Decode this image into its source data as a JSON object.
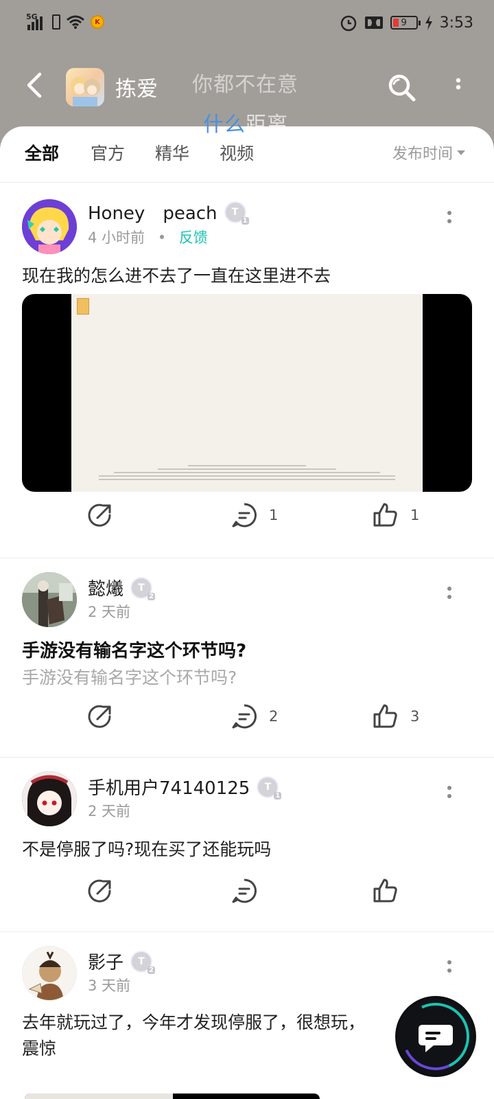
{
  "status_bar": {
    "network": "5G",
    "battery": "9",
    "time": "3:53"
  },
  "header": {
    "game_title": "拣爱",
    "lyric_line1": "你都不在意",
    "lyric_line2_highlight": "什么",
    "lyric_line2_rest": "距离"
  },
  "tabs": {
    "items": [
      "全部",
      "官方",
      "精华",
      "视频"
    ],
    "active": "全部",
    "sort_label": "发布时间"
  },
  "posts": [
    {
      "username": "Honey　peach",
      "level": "T",
      "level_num": "1",
      "time": "4 小时前",
      "separator": "•",
      "tag": "反馈",
      "text": "现在我的怎么进不去了一直在这里进不去",
      "has_video": true,
      "comments": "1",
      "likes": "1"
    },
    {
      "username": "懿爔",
      "level": "T",
      "level_num": "2",
      "time": "2 天前",
      "title": "手游没有输名字这个环节吗?",
      "subtitle": "手游没有输名字这个环节吗?",
      "comments": "2",
      "likes": "3"
    },
    {
      "username": "手机用户74140125",
      "level": "T",
      "level_num": "1",
      "time": "2 天前",
      "text": "不是停服了吗?现在买了还能玩吗",
      "comments": "",
      "likes": ""
    },
    {
      "username": "影子",
      "level": "T",
      "level_num": "2",
      "time": "3 天前",
      "text_line1": "去年就玩过了，今年才发现停服了，很想玩，",
      "text_line2": "震惊"
    }
  ],
  "colors": {
    "accent": "#19c5b2",
    "header_bg": "#a19e99",
    "lyric_highlight": "#4a90e2"
  }
}
